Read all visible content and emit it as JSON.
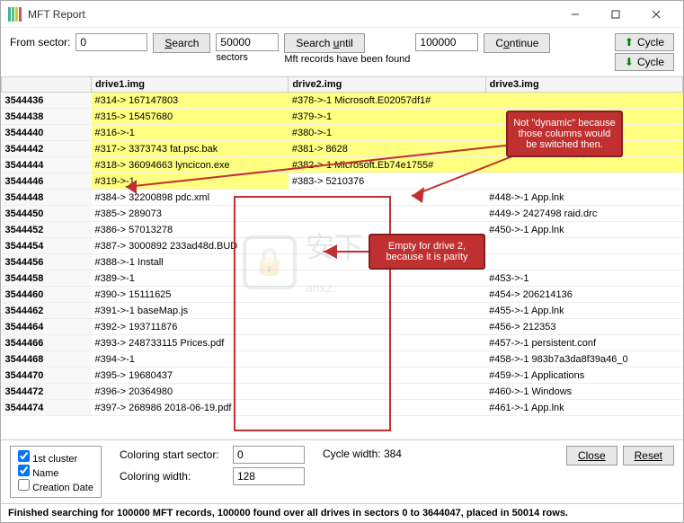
{
  "title": "MFT Report",
  "toolbar": {
    "from_sector_label": "From sector:",
    "from_sector_value": "0",
    "search_label": "Search",
    "count_value": "50000",
    "sectors_label": "sectors",
    "search_until_label": "Search until",
    "until_value": "100000",
    "status_text": "Mft records have been found",
    "continue_label": "Continue",
    "cycle_label": "Cycle"
  },
  "columns": [
    "",
    "drive1.img",
    "drive2.img",
    "drive3.img"
  ],
  "rows": [
    {
      "id": "3544436",
      "d1": "#314-> 167147803",
      "d2": "#378->-1 Microsoft.E02057df1#",
      "d3": "",
      "hl": 1
    },
    {
      "id": "3544438",
      "d1": "#315-> 15457680",
      "d2": "#379->-1",
      "d3": "",
      "hl": 1
    },
    {
      "id": "3544440",
      "d1": "#316->-1",
      "d2": "#380->-1",
      "d3": "",
      "hl": 1
    },
    {
      "id": "3544442",
      "d1": "#317-> 3373743 fat.psc.bak",
      "d2": "#381-> 8628",
      "d3": "",
      "hl": 1
    },
    {
      "id": "3544444",
      "d1": "#318-> 36094663 lyncicon.exe",
      "d2": "#382->-1 Microsoft.Eb74e1755#",
      "d3": "",
      "hl": 1
    },
    {
      "id": "3544446",
      "d1": "#319->-1",
      "d2": "#383-> 5210376",
      "d3": "",
      "hl": 2
    },
    {
      "id": "3544448",
      "d1": "#384-> 32200898 pdc.xml",
      "d2": "",
      "d3": "#448->-1 App.lnk",
      "hl": 0
    },
    {
      "id": "3544450",
      "d1": "#385-> 289073",
      "d2": "",
      "d3": "#449-> 2427498 raid.drc",
      "hl": 0
    },
    {
      "id": "3544452",
      "d1": "#386-> 57013278",
      "d2": "",
      "d3": "#450->-1 App.lnk",
      "hl": 0
    },
    {
      "id": "3544454",
      "d1": "#387-> 3000892 233ad48d.BUD",
      "d2": "",
      "d3": "",
      "hl": 0
    },
    {
      "id": "3544456",
      "d1": "#388->-1 Install",
      "d2": "",
      "d3": "",
      "hl": 0
    },
    {
      "id": "3544458",
      "d1": "#389->-1",
      "d2": "",
      "d3": "#453->-1",
      "hl": 0
    },
    {
      "id": "3544460",
      "d1": "#390-> 15111625",
      "d2": "",
      "d3": "#454-> 206214136",
      "hl": 0
    },
    {
      "id": "3544462",
      "d1": "#391->-1 baseMap.js",
      "d2": "",
      "d3": "#455->-1 App.lnk",
      "hl": 0
    },
    {
      "id": "3544464",
      "d1": "#392-> 193711876",
      "d2": "",
      "d3": "#456-> 212353",
      "hl": 0
    },
    {
      "id": "3544466",
      "d1": "#393-> 248733115 Prices.pdf",
      "d2": "",
      "d3": "#457->-1 persistent.conf",
      "hl": 0
    },
    {
      "id": "3544468",
      "d1": "#394->-1",
      "d2": "",
      "d3": "#458->-1 983b7a3da8f39a46_0",
      "hl": 0
    },
    {
      "id": "3544470",
      "d1": "#395-> 19680437",
      "d2": "",
      "d3": "#459->-1 Applications",
      "hl": 0
    },
    {
      "id": "3544472",
      "d1": "#396-> 20364980",
      "d2": "",
      "d3": "#460->-1 Windows",
      "hl": 0
    },
    {
      "id": "3544474",
      "d1": "#397-> 268986 2018-06-19.pdf",
      "d2": "",
      "d3": "#461->-1 App.lnk",
      "hl": 0
    }
  ],
  "footer": {
    "chk_1st_cluster": "1st cluster",
    "chk_name": "Name",
    "chk_creation": "Creation Date",
    "coloring_start_label": "Coloring start sector:",
    "coloring_start_value": "0",
    "coloring_width_label": "Coloring width:",
    "coloring_width_value": "128",
    "cycle_width_label": "Cycle width: 384",
    "close_label": "Close",
    "reset_label": "Reset"
  },
  "status_bar": "Finished searching for 100000 MFT records, 100000 found over all drives in sectors 0 to 3644047, placed in 50014 rows.",
  "callouts": {
    "c1": "Not \"dynamic\" because those columns would be switched then.",
    "c2": "Empty for drive 2, because it is parity"
  }
}
